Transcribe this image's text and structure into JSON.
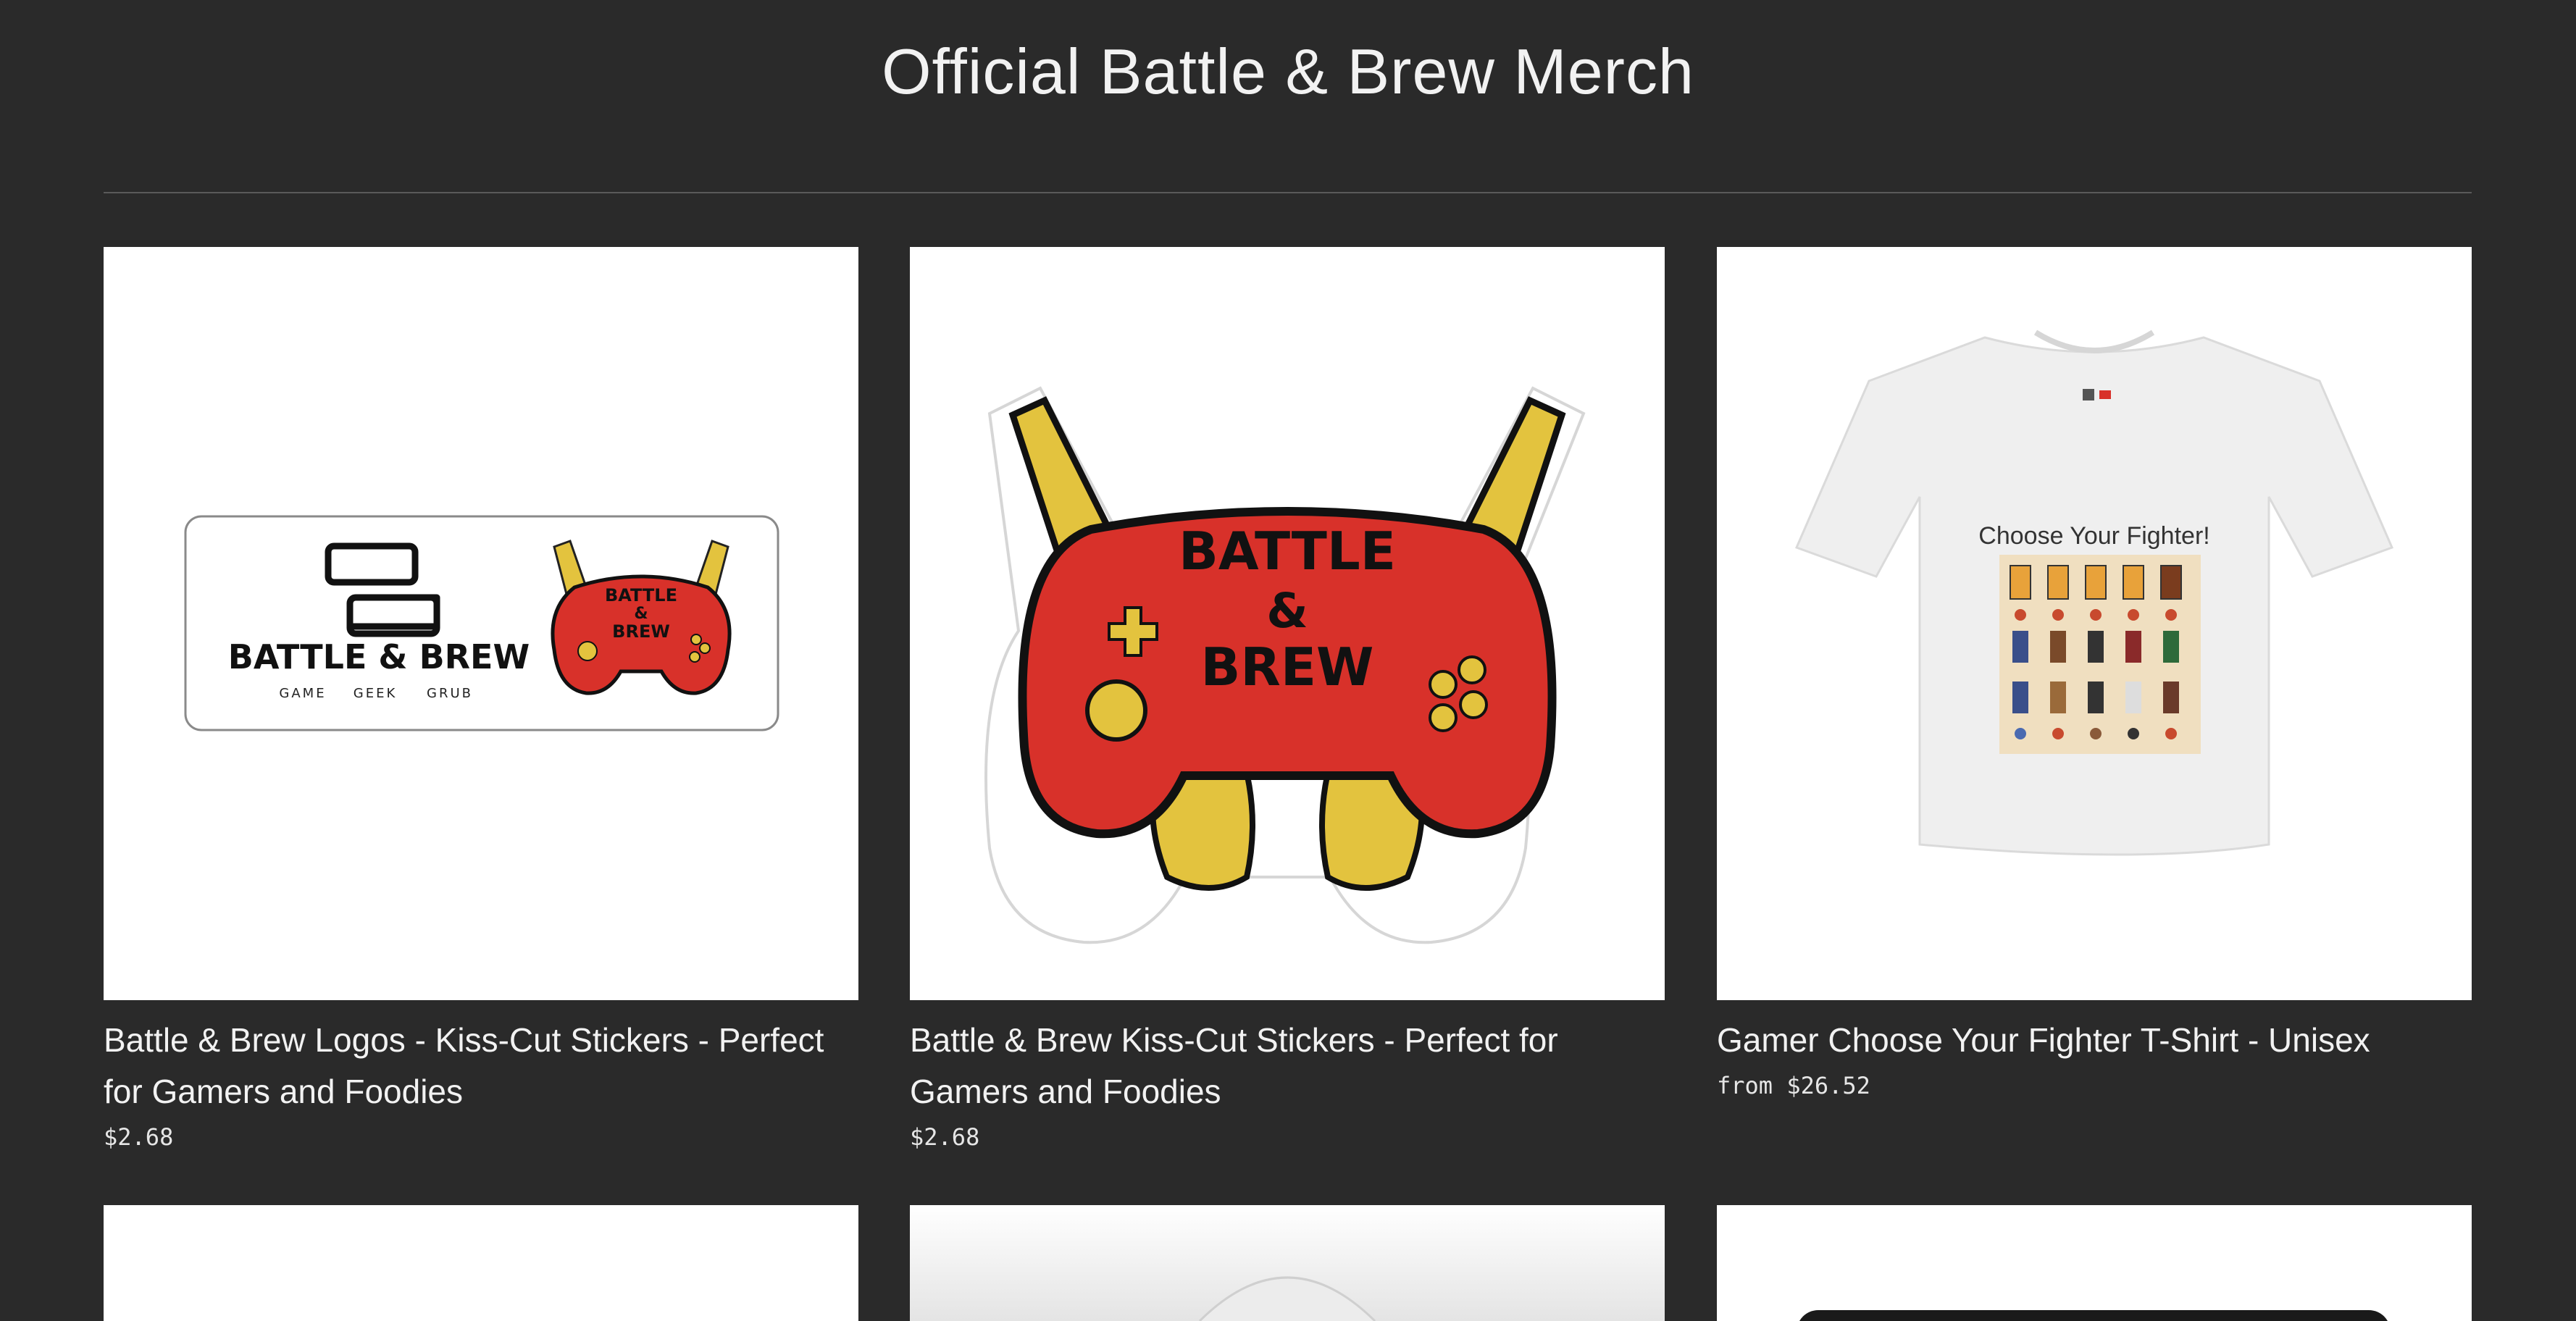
{
  "page": {
    "title": "Official Battle & Brew Merch"
  },
  "products": [
    {
      "name": "Battle & Brew Logos - Kiss-Cut Stickers - Perfect for Gamers and Foodies",
      "price": "$2.68",
      "image": "battle-brew-logos-sticker"
    },
    {
      "name": "Battle & Brew Kiss-Cut Stickers - Perfect for Gamers and Foodies",
      "price": "$2.68",
      "image": "battle-brew-controller-sticker"
    },
    {
      "name": "Gamer Choose Your Fighter T-Shirt - Unisex",
      "price": "from $26.52",
      "image": "choose-your-fighter-tshirt"
    }
  ],
  "stickers": {
    "brand": "BATTLE & BREW",
    "tagline": [
      "GAME",
      "GEEK",
      "GRUB"
    ],
    "controller_lines": [
      "BATTLE",
      "&",
      "BREW"
    ]
  },
  "tshirt": {
    "print_text": "Choose Your Fighter!"
  },
  "colors": {
    "background": "#2a2a2a",
    "controller_red": "#d8312a",
    "bottle_yellow": "#e3c33e"
  }
}
